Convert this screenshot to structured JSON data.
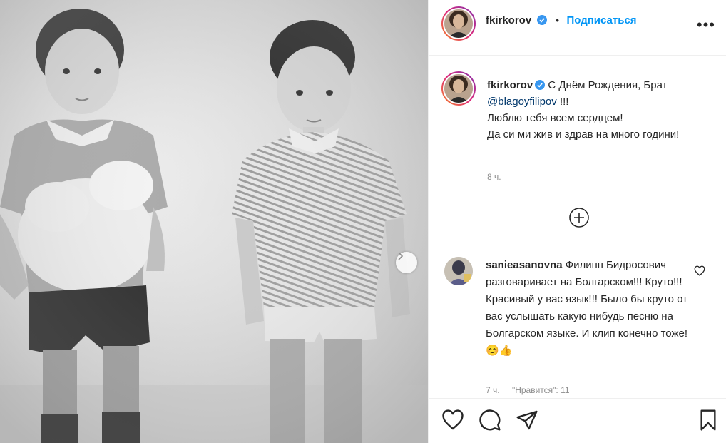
{
  "post": {
    "author": "fkirkorov",
    "follow_label": "Подписаться",
    "caption_intro": "С Днём Рождения, Брат",
    "caption_mention": "@blagoyfilipov",
    "caption_exclaim": "!!!",
    "caption_line2": "Люблю тебя всем сердцем!",
    "caption_line3": "Да си ми жив и здрав на много години!",
    "time": "8 ч."
  },
  "comment": {
    "author": "sanieasanovna",
    "text": "Филипп Бидросович разговаривает на Болгарском!!! Круто!!! Красивый у вас язык!!! Было бы круто от вас услышать какую нибудь песню на Болгарском языке. И клип конечно тоже!",
    "emoji": "😊👍",
    "time": "7 ч.",
    "likes": "\"Нравится\": 11"
  },
  "icons": {
    "verified": "verified-badge-icon",
    "more": "more-options-icon",
    "load_more": "plus-circle-icon",
    "like": "heart-icon",
    "comment": "comment-bubble-icon",
    "share": "paper-plane-icon",
    "save": "bookmark-icon",
    "next": "chevron-right-icon"
  },
  "colors": {
    "link": "#0095f6",
    "mention": "#00376b",
    "muted": "#8e8e8e",
    "text": "#262626"
  }
}
